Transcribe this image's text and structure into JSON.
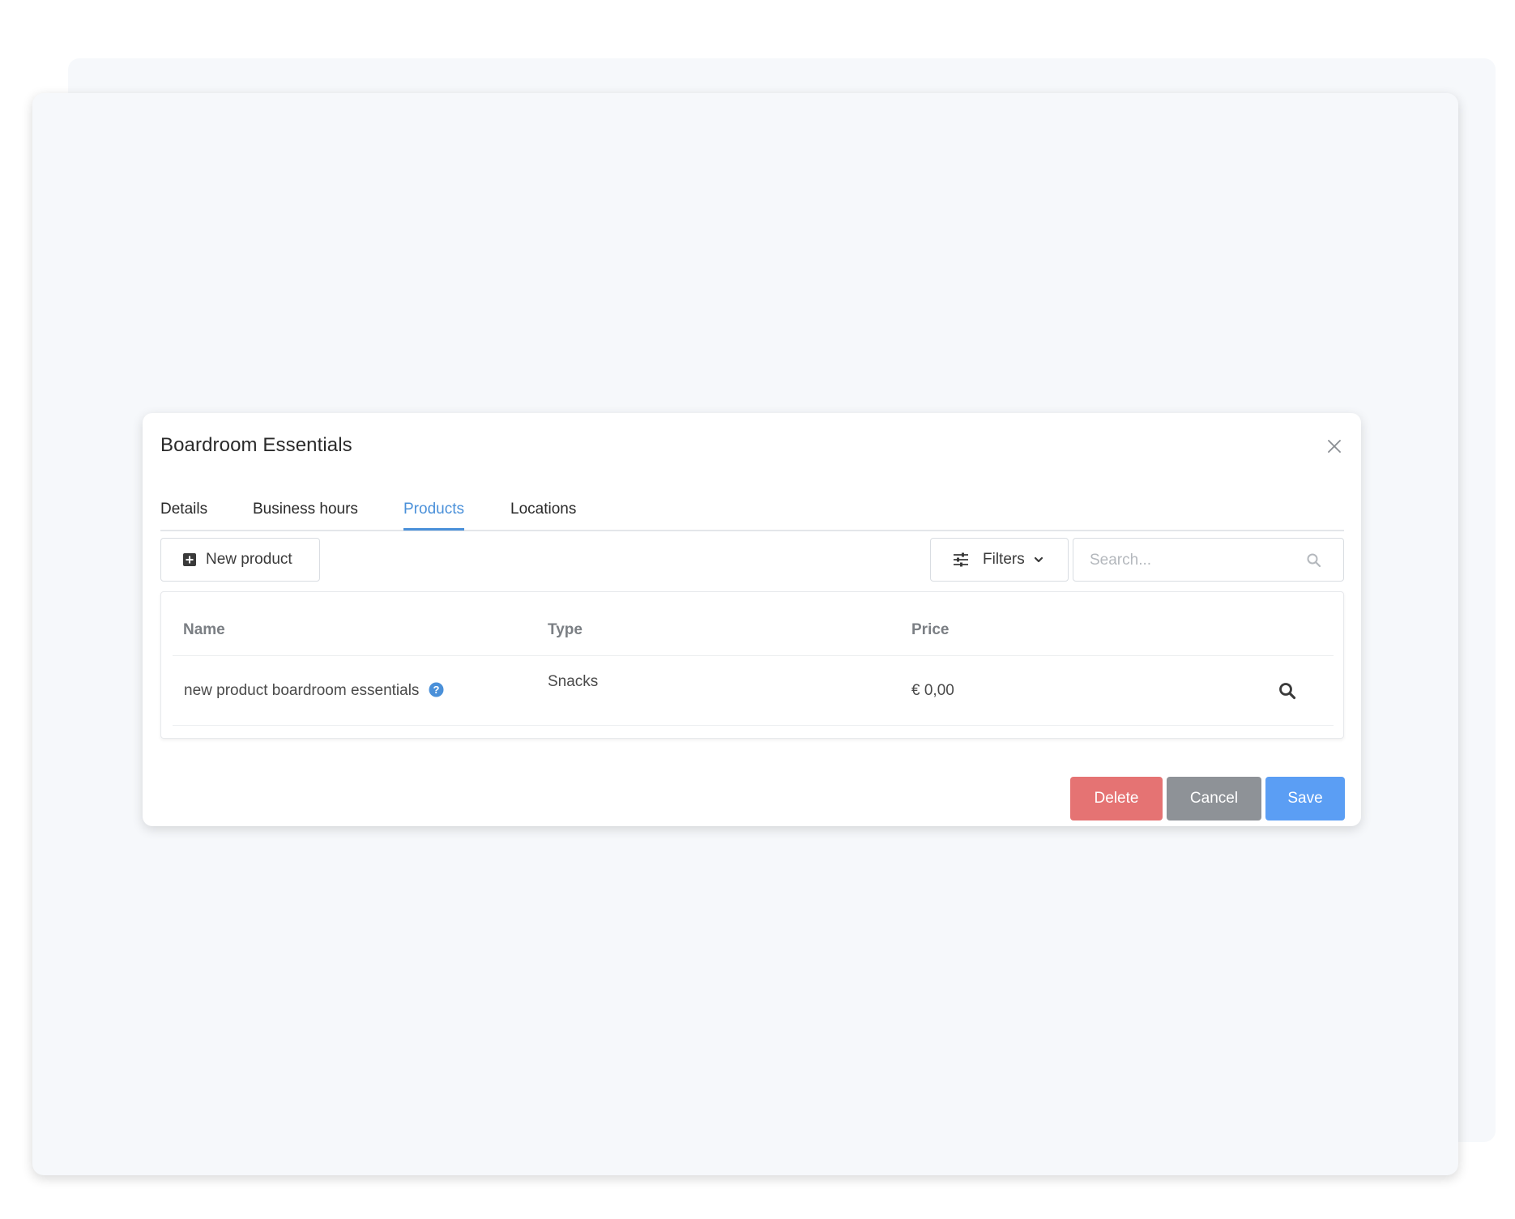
{
  "modal": {
    "title": "Boardroom Essentials",
    "close_icon": "close-icon"
  },
  "tabs": [
    {
      "label": "Details",
      "active": false
    },
    {
      "label": "Business hours",
      "active": false
    },
    {
      "label": "Products",
      "active": true
    },
    {
      "label": "Locations",
      "active": false
    }
  ],
  "toolbar": {
    "new_product_label": "New product",
    "new_product_icon": "plus-square-icon",
    "filters_label": "Filters",
    "filters_icon": "sliders-icon",
    "search_placeholder": "Search...",
    "search_value": ""
  },
  "table": {
    "columns": [
      "Name",
      "Type",
      "Price"
    ],
    "rows": [
      {
        "name": "new product boardroom essentials",
        "type": "Snacks",
        "price": "€ 0,00",
        "has_help_icon": true
      }
    ]
  },
  "actions": {
    "delete_label": "Delete",
    "cancel_label": "Cancel",
    "save_label": "Save"
  },
  "colors": {
    "accent": "#4a90d9",
    "delete": "#e57373",
    "cancel": "#8e9297",
    "save": "#5b9ef4",
    "background": "#f6f8fb"
  }
}
